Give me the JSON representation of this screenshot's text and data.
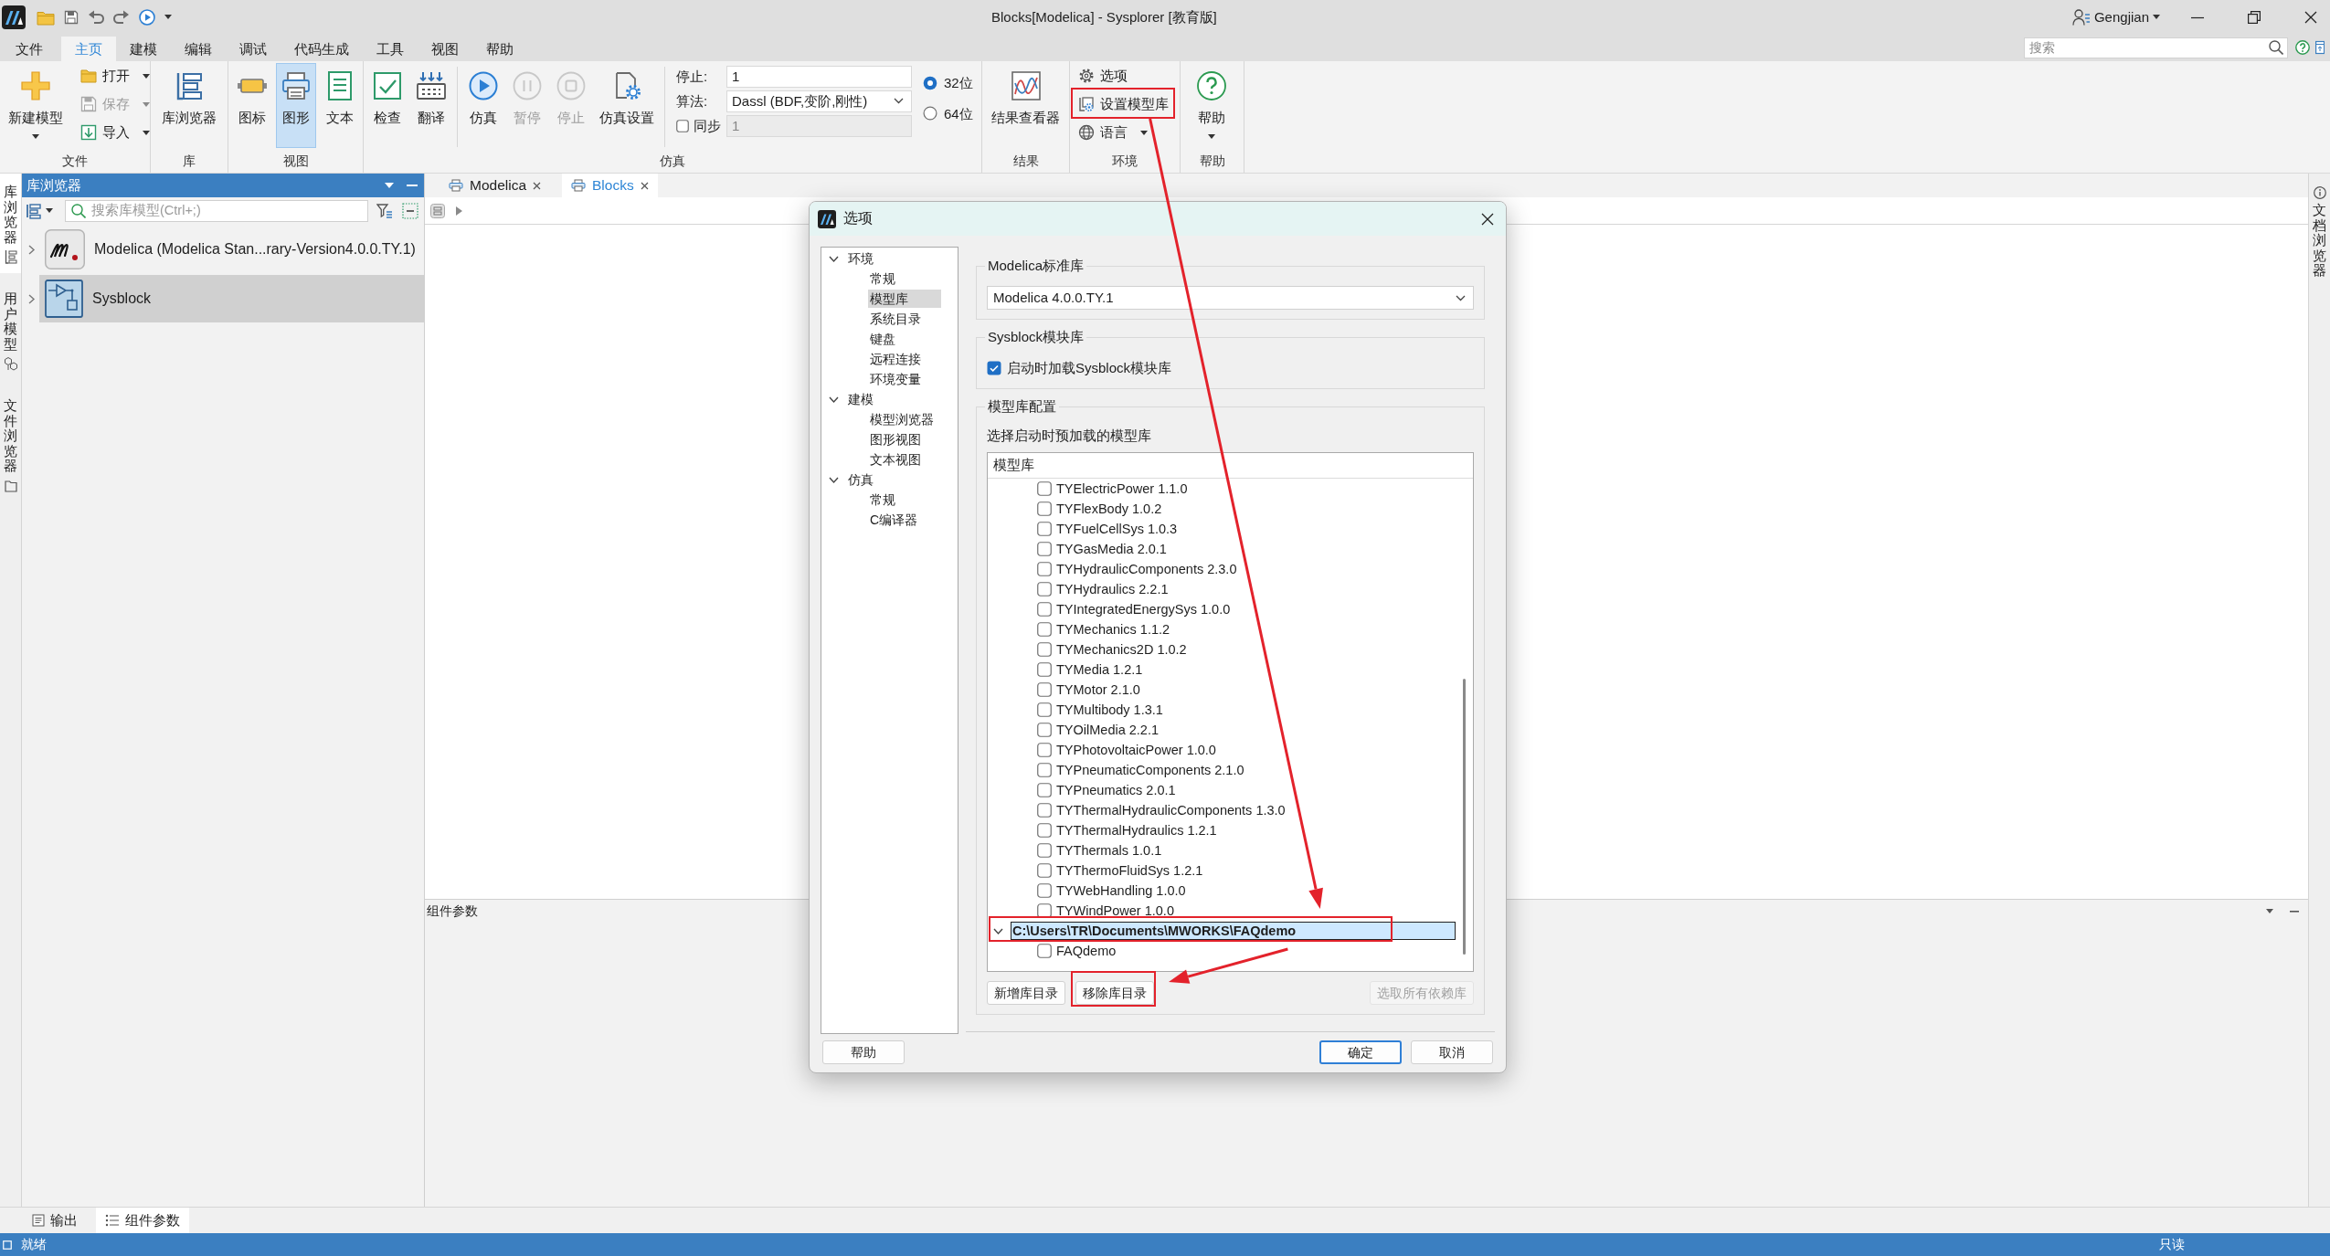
{
  "window": {
    "title": "Blocks[Modelica] - Sysplorer [教育版]",
    "user": "Gengjian"
  },
  "menu_tabs": [
    {
      "label": "文件",
      "selected": false
    },
    {
      "label": "主页",
      "selected": true
    },
    {
      "label": "建模",
      "selected": false
    },
    {
      "label": "编辑",
      "selected": false
    },
    {
      "label": "调试",
      "selected": false
    },
    {
      "label": "代码生成",
      "selected": false
    },
    {
      "label": "工具",
      "selected": false
    },
    {
      "label": "视图",
      "selected": false
    },
    {
      "label": "帮助",
      "selected": false
    }
  ],
  "search": {
    "placeholder": "搜索"
  },
  "ribbon": {
    "groups": [
      {
        "label": "文件",
        "items": [
          {
            "kind": "large",
            "label": "新建模型",
            "dropdown": true,
            "disabled": false
          },
          {
            "kind": "small",
            "label": "打开",
            "dropdown": true,
            "disabled": false
          },
          {
            "kind": "small",
            "label": "保存",
            "dropdown": true,
            "disabled": true
          },
          {
            "kind": "small",
            "label": "导入",
            "dropdown": true,
            "disabled": false
          }
        ]
      },
      {
        "label": "库",
        "items": [
          {
            "kind": "large",
            "label": "库浏览器"
          }
        ]
      },
      {
        "label": "视图",
        "items": [
          {
            "kind": "large",
            "label": "图标",
            "selected": false
          },
          {
            "kind": "large",
            "label": "图形",
            "selected": true
          },
          {
            "kind": "large",
            "label": "文本",
            "selected": false
          }
        ]
      },
      {
        "label": "仿真",
        "sections": [
          {
            "items": [
              {
                "kind": "large",
                "label": "检查",
                "disabled": false
              },
              {
                "kind": "large",
                "label": "翻译",
                "disabled": false
              }
            ]
          },
          {
            "items": [
              {
                "kind": "large",
                "label": "仿真",
                "disabled": false
              },
              {
                "kind": "large",
                "label": "暂停",
                "disabled": true
              },
              {
                "kind": "large",
                "label": "停止",
                "disabled": true
              },
              {
                "kind": "large",
                "label": "仿真设置",
                "disabled": false
              }
            ]
          }
        ],
        "settings": [
          {
            "kind": "input",
            "label": "停止:",
            "value": "1",
            "disabled": false
          },
          {
            "kind": "select",
            "label": "算法:",
            "value": "Dassl (BDF,变阶,刚性)",
            "disabled": false
          },
          {
            "kind": "checkbox-input",
            "label": "同步",
            "checked": false,
            "value": "1",
            "disabled": true
          }
        ],
        "radios": [
          {
            "label": "32位",
            "selected": true
          },
          {
            "label": "64位",
            "selected": false
          }
        ]
      },
      {
        "label": "结果",
        "items": [
          {
            "kind": "large",
            "label": "结果查看器"
          }
        ]
      },
      {
        "label": "环境",
        "items": [
          {
            "kind": "small",
            "label": "选项",
            "dropdown": false,
            "highlighted": false
          },
          {
            "kind": "small",
            "label": "设置模型库",
            "dropdown": false,
            "highlighted": true
          },
          {
            "kind": "small",
            "label": "语言",
            "dropdown": true,
            "highlighted": false
          }
        ]
      },
      {
        "label": "帮助",
        "items": [
          {
            "kind": "large",
            "label": "帮助",
            "dropdown": true
          }
        ]
      }
    ]
  },
  "side_tabs": [
    {
      "label": "库浏览器",
      "selected": true
    },
    {
      "label": "用户模型",
      "selected": false
    },
    {
      "label": "文件浏览器",
      "selected": false
    }
  ],
  "library_browser": {
    "title": "库浏览器",
    "search_placeholder": "搜索库模型(Ctrl+;)",
    "items": [
      {
        "label": "Modelica (Modelica Stan...rary-Version4.0.0.TY.1)",
        "expanded": false,
        "selected": false
      },
      {
        "label": "Sysblock",
        "expanded": false,
        "selected": true
      }
    ]
  },
  "editor_tabs": [
    {
      "label": "Modelica",
      "selected": false
    },
    {
      "label": "Blocks",
      "selected": true
    }
  ],
  "properties_pane": {
    "title": "组件参数"
  },
  "right_side_tabs": [
    {
      "label": "文档浏览器",
      "selected": false
    }
  ],
  "bottom_tabs": [
    {
      "label": "输出",
      "selected": false
    },
    {
      "label": "组件参数",
      "selected": true
    }
  ],
  "status_bar": {
    "message": "就绪",
    "mode": "只读"
  },
  "dialog": {
    "title": "选项",
    "nav": [
      {
        "label": "环境",
        "expanded": true,
        "selected": false,
        "children": [
          {
            "label": "常规",
            "selected": false
          },
          {
            "label": "模型库",
            "selected": true
          },
          {
            "label": "系统目录",
            "selected": false
          },
          {
            "label": "键盘",
            "selected": false
          },
          {
            "label": "远程连接",
            "selected": false
          },
          {
            "label": "环境变量",
            "selected": false
          }
        ]
      },
      {
        "label": "建模",
        "expanded": true,
        "selected": false,
        "children": [
          {
            "label": "模型浏览器",
            "selected": false
          },
          {
            "label": "图形视图",
            "selected": false
          },
          {
            "label": "文本视图",
            "selected": false
          }
        ]
      },
      {
        "label": "仿真",
        "expanded": true,
        "selected": false,
        "children": [
          {
            "label": "常规",
            "selected": false
          },
          {
            "label": "C编译器",
            "selected": false
          }
        ]
      }
    ],
    "standard_library": {
      "title": "Modelica标准库",
      "value": "Modelica 4.0.0.TY.1"
    },
    "sysblock_library": {
      "title": "Sysblock模块库",
      "option": {
        "label": "启动时加载Sysblock模块库",
        "checked": true
      }
    },
    "library_config": {
      "title": "模型库配置",
      "hint": "选择启动时预加载的模型库",
      "column": "模型库",
      "tree": [
        {
          "children": [
            {
              "label": "TYElectricPower 1.1.0",
              "checked": false,
              "selected": false,
              "highlighted": false
            },
            {
              "label": "TYFlexBody 1.0.2",
              "checked": false,
              "selected": false,
              "highlighted": false
            },
            {
              "label": "TYFuelCellSys 1.0.3",
              "checked": false,
              "selected": false,
              "highlighted": false
            },
            {
              "label": "TYGasMedia 2.0.1",
              "checked": false,
              "selected": false,
              "highlighted": false
            },
            {
              "label": "TYHydraulicComponents 2.3.0",
              "checked": false,
              "selected": false,
              "highlighted": false
            },
            {
              "label": "TYHydraulics 2.2.1",
              "checked": false,
              "selected": false,
              "highlighted": false
            },
            {
              "label": "TYIntegratedEnergySys 1.0.0",
              "checked": false,
              "selected": false,
              "highlighted": false
            },
            {
              "label": "TYMechanics 1.1.2",
              "checked": false,
              "selected": false,
              "highlighted": false
            },
            {
              "label": "TYMechanics2D 1.0.2",
              "checked": false,
              "selected": false,
              "highlighted": false
            },
            {
              "label": "TYMedia 1.2.1",
              "checked": false,
              "selected": false,
              "highlighted": false
            },
            {
              "label": "TYMotor 2.1.0",
              "checked": false,
              "selected": false,
              "highlighted": false
            },
            {
              "label": "TYMultibody 1.3.1",
              "checked": false,
              "selected": false,
              "highlighted": false
            },
            {
              "label": "TYOilMedia 2.2.1",
              "checked": false,
              "selected": false,
              "highlighted": false
            },
            {
              "label": "TYPhotovoltaicPower 1.0.0",
              "checked": false,
              "selected": false,
              "highlighted": false
            },
            {
              "label": "TYPneumaticComponents 2.1.0",
              "checked": false,
              "selected": false,
              "highlighted": false
            },
            {
              "label": "TYPneumatics 2.0.1",
              "checked": false,
              "selected": false,
              "highlighted": false
            },
            {
              "label": "TYThermalHydraulicComponents 1.3.0",
              "checked": false,
              "selected": false,
              "highlighted": false
            },
            {
              "label": "TYThermalHydraulics 1.2.1",
              "checked": false,
              "selected": false,
              "highlighted": false
            },
            {
              "label": "TYThermals 1.0.1",
              "checked": false,
              "selected": false,
              "highlighted": false
            },
            {
              "label": "TYThermoFluidSys 1.2.1",
              "checked": false,
              "selected": false,
              "highlighted": false
            },
            {
              "label": "TYWebHandling 1.0.0",
              "checked": false,
              "selected": false,
              "highlighted": false
            },
            {
              "label": "TYWindPower 1.0.0",
              "checked": false,
              "selected": false,
              "highlighted": false
            }
          ]
        },
        {
          "label": "C:\\Users\\TR\\Documents\\MWORKS\\FAQdemo",
          "expanded": true,
          "selected": true,
          "highlighted": true,
          "children": [
            {
              "label": "FAQdemo",
              "checked": false,
              "selected": false,
              "highlighted": false
            }
          ]
        }
      ],
      "buttons": [
        {
          "label": "新增库目录",
          "disabled": false,
          "highlighted": false
        },
        {
          "label": "移除库目录",
          "disabled": false,
          "highlighted": true
        },
        {
          "label": "选取所有依赖库",
          "disabled": true,
          "highlighted": false
        }
      ]
    },
    "buttons": [
      {
        "label": "帮助",
        "default": false
      },
      {
        "label": "确定",
        "default": true
      },
      {
        "label": "取消",
        "default": false
      }
    ]
  }
}
